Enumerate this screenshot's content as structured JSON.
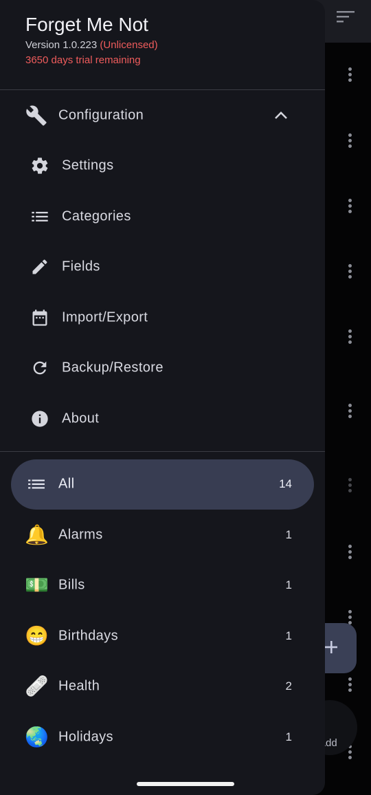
{
  "app": {
    "title": "Forget Me Not",
    "version": "Version 1.0.223",
    "license_status": "(Unlicensed)",
    "trial": "3650 days trial remaining"
  },
  "config_section": {
    "label": "Configuration",
    "icon": "wrench-icon",
    "expanded": true,
    "items": [
      {
        "label": "Settings",
        "icon": "gear-icon"
      },
      {
        "label": "Categories",
        "icon": "list-icon"
      },
      {
        "label": "Fields",
        "icon": "pencil-icon"
      },
      {
        "label": "Import/Export",
        "icon": "calendar-icon"
      },
      {
        "label": "Backup/Restore",
        "icon": "refresh-icon"
      },
      {
        "label": "About",
        "icon": "info-icon"
      }
    ]
  },
  "categories": {
    "active": "All",
    "items": [
      {
        "label": "All",
        "count": "14",
        "icon": "list-icon"
      },
      {
        "label": "Alarms",
        "count": "1",
        "icon": "🔔"
      },
      {
        "label": "Bills",
        "count": "1",
        "icon": "💵"
      },
      {
        "label": "Birthdays",
        "count": "1",
        "icon": "😁"
      },
      {
        "label": "Health",
        "count": "2",
        "icon": "🩹"
      },
      {
        "label": "Holidays",
        "count": "1",
        "icon": "🌏"
      }
    ]
  },
  "background": {
    "fab_icon": "plus-icon",
    "extended_fab_label": "Add"
  },
  "colors": {
    "drawer_bg": "#15161c",
    "active_pill": "#383d52",
    "warning": "#ef5c5c"
  }
}
